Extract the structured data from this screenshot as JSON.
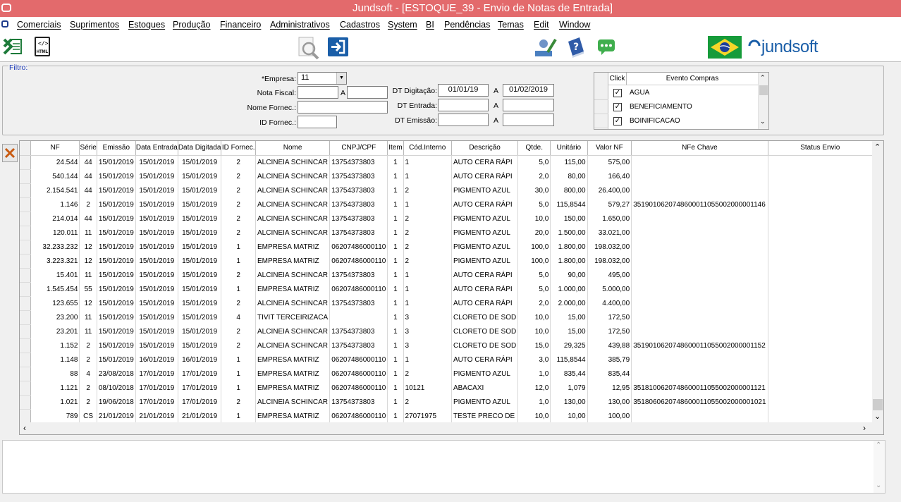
{
  "window": {
    "title": "Jundsoft - [ESTOQUE_39 - Envio de Notas de Entrada]"
  },
  "menu": [
    "Comerciais",
    "Suprimentos",
    "Estoques",
    "Produção",
    "Financeiro",
    "Administrativos",
    "Cadastros",
    "System",
    "BI",
    "Pendências",
    "Temas",
    "Edit",
    "Window"
  ],
  "toolbar": {
    "html_icon_label": "HTML",
    "brand": "jundsoft"
  },
  "filter": {
    "legend": "Filtro:",
    "empresa_label": "*Empresa:",
    "empresa_value": "11",
    "nota_label": "Nota Fiscal:",
    "nota_a": "A",
    "fornec_label": "Nome Fornec.:",
    "idfornec_label": "ID Fornec.:",
    "dtdig_label": "DT Digitação:",
    "dtdig_from": "01/01/19",
    "dtdig_a": "A",
    "dtdig_to": "01/02/2019",
    "dtent_label": "DT Entrada:",
    "dtent_a": "A",
    "dtemi_label": "DT Emissão:",
    "dtemi_a": "A"
  },
  "eventos": {
    "col_click": "Click",
    "col_evento": "Evento Compras",
    "items": [
      {
        "label": "AGUA",
        "checked": true
      },
      {
        "label": "BENEFICIAMENTO",
        "checked": true
      },
      {
        "label": "BOINIFICACAO",
        "checked": true
      }
    ]
  },
  "grid": {
    "columns": [
      "NF",
      "Série",
      "Emissão",
      "Data Entrada",
      "Data Digitada",
      "ID Fornec.",
      "Nome",
      "CNPJ/CPF",
      "Item",
      "Cód.Interno",
      "Descrição",
      "Qtde.",
      "Unitário",
      "Valor NF",
      "NFe Chave",
      "Status Envio"
    ],
    "rows": [
      [
        "24.544",
        "44",
        "15/01/2019",
        "15/01/2019",
        "15/01/2019",
        "2",
        "ALCINEIA SCHINCAR",
        "13754373803",
        "1",
        "1",
        "AUTO CERA RÁPI",
        "5,0",
        "115,00",
        "575,00",
        "",
        ""
      ],
      [
        "540.144",
        "44",
        "15/01/2019",
        "15/01/2019",
        "15/01/2019",
        "2",
        "ALCINEIA SCHINCAR",
        "13754373803",
        "1",
        "1",
        "AUTO CERA RÁPI",
        "2,0",
        "80,00",
        "166,40",
        "",
        ""
      ],
      [
        "2.154.541",
        "44",
        "15/01/2019",
        "15/01/2019",
        "15/01/2019",
        "2",
        "ALCINEIA SCHINCAR",
        "13754373803",
        "1",
        "2",
        "PIGMENTO AZUL",
        "30,0",
        "800,00",
        "26.400,00",
        "",
        ""
      ],
      [
        "1.146",
        "2",
        "15/01/2019",
        "15/01/2019",
        "15/01/2019",
        "2",
        "ALCINEIA SCHINCAR",
        "13754373803",
        "1",
        "1",
        "AUTO CERA RÁPI",
        "5,0",
        "115,8544",
        "579,27",
        "3519010620748600011055002000001146",
        ""
      ],
      [
        "214.014",
        "44",
        "15/01/2019",
        "15/01/2019",
        "15/01/2019",
        "2",
        "ALCINEIA SCHINCAR",
        "13754373803",
        "1",
        "2",
        "PIGMENTO AZUL",
        "10,0",
        "150,00",
        "1.650,00",
        "",
        ""
      ],
      [
        "120.011",
        "11",
        "15/01/2019",
        "15/01/2019",
        "15/01/2019",
        "2",
        "ALCINEIA SCHINCAR",
        "13754373803",
        "1",
        "2",
        "PIGMENTO AZUL",
        "20,0",
        "1.500,00",
        "33.021,00",
        "",
        ""
      ],
      [
        "32.233.232",
        "12",
        "15/01/2019",
        "15/01/2019",
        "15/01/2019",
        "1",
        "EMPRESA MATRIZ",
        "06207486000110",
        "1",
        "2",
        "PIGMENTO AZUL",
        "100,0",
        "1.800,00",
        "198.032,00",
        "",
        ""
      ],
      [
        "3.223.321",
        "12",
        "15/01/2019",
        "15/01/2019",
        "15/01/2019",
        "1",
        "EMPRESA MATRIZ",
        "06207486000110",
        "1",
        "2",
        "PIGMENTO AZUL",
        "100,0",
        "1.800,00",
        "198.032,00",
        "",
        ""
      ],
      [
        "15.401",
        "11",
        "15/01/2019",
        "15/01/2019",
        "15/01/2019",
        "2",
        "ALCINEIA SCHINCAR",
        "13754373803",
        "1",
        "1",
        "AUTO CERA RÁPI",
        "5,0",
        "90,00",
        "495,00",
        "",
        ""
      ],
      [
        "1.545.454",
        "55",
        "15/01/2019",
        "15/01/2019",
        "15/01/2019",
        "1",
        "EMPRESA MATRIZ",
        "06207486000110",
        "1",
        "1",
        "AUTO CERA RÁPI",
        "5,0",
        "1.000,00",
        "5.000,00",
        "",
        ""
      ],
      [
        "123.655",
        "12",
        "15/01/2019",
        "15/01/2019",
        "15/01/2019",
        "2",
        "ALCINEIA SCHINCAR",
        "13754373803",
        "1",
        "1",
        "AUTO CERA RÁPI",
        "2,0",
        "2.000,00",
        "4.400,00",
        "",
        ""
      ],
      [
        "23.200",
        "11",
        "15/01/2019",
        "15/01/2019",
        "15/01/2019",
        "4",
        "TIVIT TERCEIRIZACA",
        "",
        "1",
        "3",
        "CLORETO DE SOD",
        "10,0",
        "15,00",
        "172,50",
        "",
        ""
      ],
      [
        "23.201",
        "11",
        "15/01/2019",
        "15/01/2019",
        "15/01/2019",
        "2",
        "ALCINEIA SCHINCAR",
        "13754373803",
        "1",
        "3",
        "CLORETO DE SOD",
        "10,0",
        "15,00",
        "172,50",
        "",
        ""
      ],
      [
        "1.152",
        "2",
        "15/01/2019",
        "15/01/2019",
        "15/01/2019",
        "2",
        "ALCINEIA SCHINCAR",
        "13754373803",
        "1",
        "3",
        "CLORETO DE SOD",
        "15,0",
        "29,325",
        "439,88",
        "3519010620748600011055002000001152",
        ""
      ],
      [
        "1.148",
        "2",
        "15/01/2019",
        "16/01/2019",
        "16/01/2019",
        "1",
        "EMPRESA MATRIZ",
        "06207486000110",
        "1",
        "1",
        "AUTO CERA RÁPI",
        "3,0",
        "115,8544",
        "385,79",
        "",
        ""
      ],
      [
        "88",
        "4",
        "23/08/2018",
        "17/01/2019",
        "17/01/2019",
        "1",
        "EMPRESA MATRIZ",
        "06207486000110",
        "1",
        "2",
        "PIGMENTO AZUL",
        "1,0",
        "835,44",
        "835,44",
        "",
        ""
      ],
      [
        "1.121",
        "2",
        "08/10/2018",
        "17/01/2019",
        "17/01/2019",
        "1",
        "EMPRESA MATRIZ",
        "06207486000110",
        "1",
        "10121",
        "ABACAXI",
        "12,0",
        "1,079",
        "12,95",
        "3518100620748600011055002000001121",
        ""
      ],
      [
        "1.021",
        "2",
        "19/06/2018",
        "17/01/2019",
        "17/01/2019",
        "2",
        "ALCINEIA SCHINCAR",
        "13754373803",
        "1",
        "2",
        "PIGMENTO AZUL",
        "1,0",
        "130,00",
        "130,00",
        "3518060620748600011055002000001021",
        ""
      ],
      [
        "789",
        "CS",
        "21/01/2019",
        "21/01/2019",
        "21/01/2019",
        "1",
        "EMPRESA MATRIZ",
        "06207486000110",
        "1",
        "27071975",
        "TESTE PRECO DE",
        "10,0",
        "10,00",
        "100,00",
        "",
        ""
      ]
    ]
  }
}
